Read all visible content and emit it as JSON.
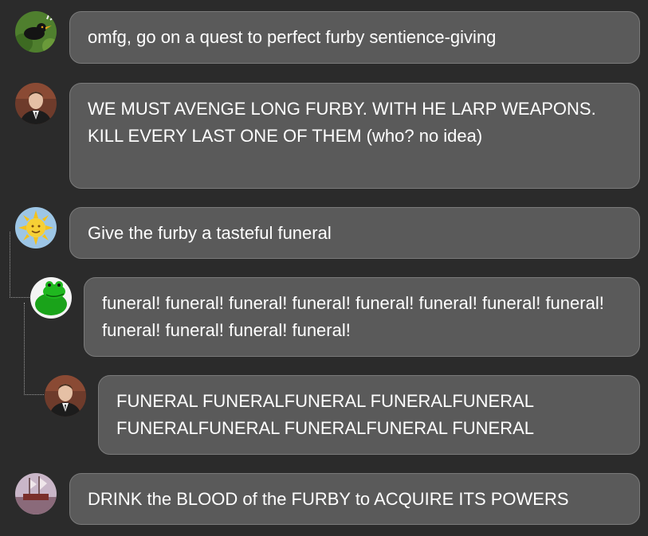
{
  "messages": [
    {
      "avatar": "blackbird-avatar",
      "text": "omfg, go on a quest to perfect furby sentience-giving"
    },
    {
      "avatar": "man-in-suit-avatar",
      "text": "WE MUST AVENGE LONG FURBY. WITH HE LARP WEAPONS. KILL EVERY LAST ONE OF THEM (who? no idea)"
    },
    {
      "avatar": "sun-face-avatar",
      "text": "Give the furby a tasteful funeral"
    },
    {
      "avatar": "green-frog-avatar",
      "text": "funeral! funeral! funeral! funeral! funeral! funeral! funeral! funeral! funeral! funeral! funeral! funeral!"
    },
    {
      "avatar": "man-in-suit-avatar",
      "text": "FUNERAL FUNERALFUNERAL FUNERALFUNERAL FUNERALFUNERAL FUNERALFUNERAL FUNERAL"
    },
    {
      "avatar": "ship-painting-avatar",
      "text": "DRINK the BLOOD of the FURBY to ACQUIRE ITS POWERS"
    }
  ],
  "colors": {
    "background": "#2b2b2b",
    "bubble": "#5a5a5a",
    "bubble_border": "#7a7a7a",
    "text": "#ffffff",
    "thread_line": "#9a9a9a"
  }
}
